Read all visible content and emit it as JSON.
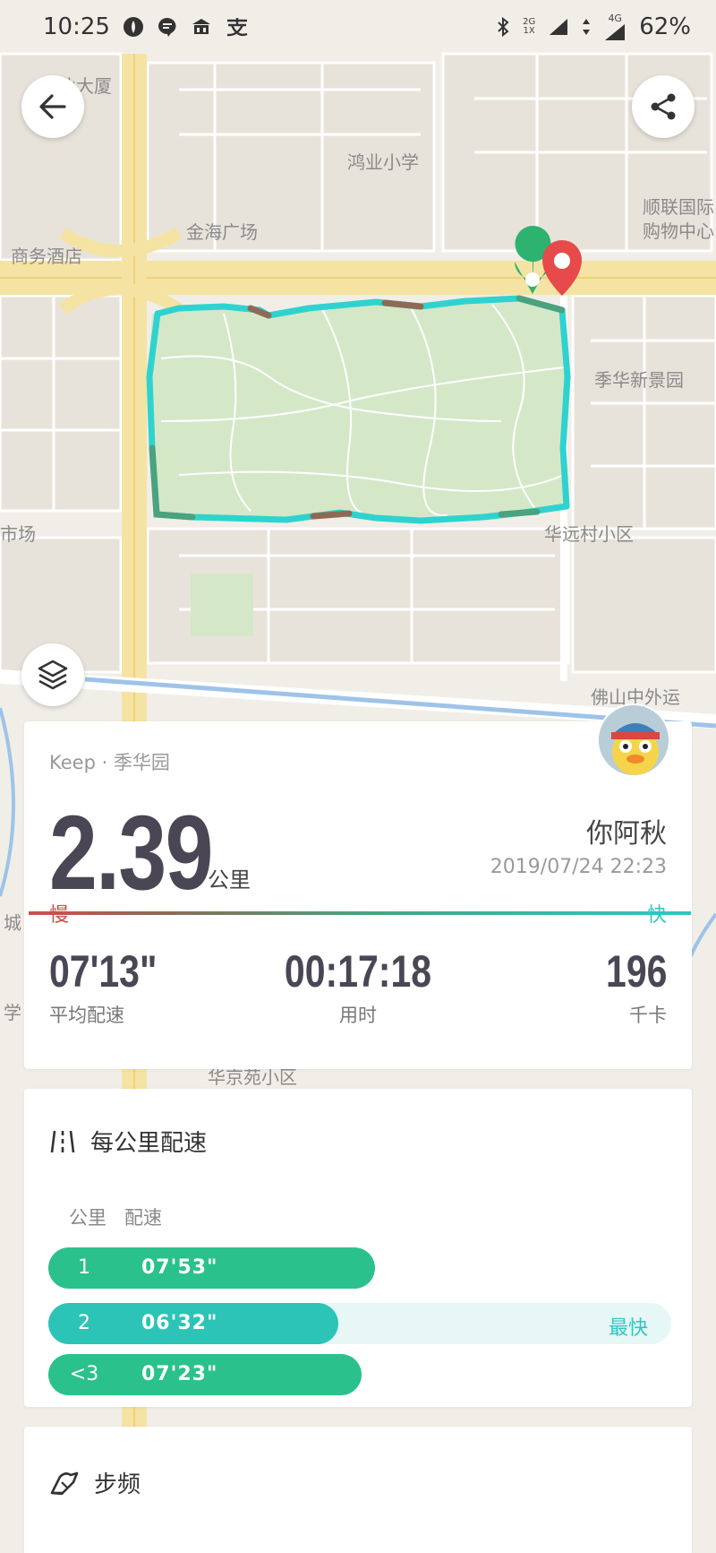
{
  "status_bar": {
    "time": "10:25",
    "network_2g": "2G",
    "network_1x": "1X",
    "network_4g": "4G",
    "battery": "62%",
    "icons": [
      "app-icon",
      "message-icon",
      "bank-icon",
      "alipay-icon",
      "bluetooth-icon",
      "signal-icon"
    ]
  },
  "map": {
    "labels": [
      "业大厦",
      "鸿业小学",
      "顺联国际",
      "购物中心",
      "金海广场",
      "商务酒店",
      "季华新景园",
      "市场",
      "华远村小区",
      "城",
      "学",
      "佛山中外运",
      "华京苑小区"
    ],
    "route_colors": {
      "fast": "#2ed3cf",
      "mid": "#4aa27f",
      "slow": "#8e6a55"
    },
    "park_color": "#d4e8c8"
  },
  "summary": {
    "source": "Keep · 季华园",
    "distance": "2.39",
    "distance_unit": "公里",
    "user_name": "你阿秋",
    "datetime": "2019/07/24 22:23",
    "slow_label": "慢",
    "fast_label": "快",
    "avg_pace": "07'13\"",
    "avg_pace_label": "平均配速",
    "duration": "00:17:18",
    "duration_label": "用时",
    "calories": "196",
    "calories_label": "千卡"
  },
  "pace_card": {
    "title": "每公里配速",
    "col_km": "公里",
    "col_pace": "配速",
    "splits": [
      {
        "km": "1",
        "pace": "07'53\"",
        "fill_fraction": 0.524,
        "color": "#2bc18c",
        "tag": ""
      },
      {
        "km": "2",
        "pace": "06'32\"",
        "fill_fraction": 0.466,
        "color": "#2cc4b6",
        "tag": "最快"
      },
      {
        "km": "<3",
        "pace": "07'23\"",
        "fill_fraction": 0.503,
        "color": "#2bc18c",
        "tag": ""
      }
    ]
  },
  "cadence_card": {
    "title": "步频"
  }
}
